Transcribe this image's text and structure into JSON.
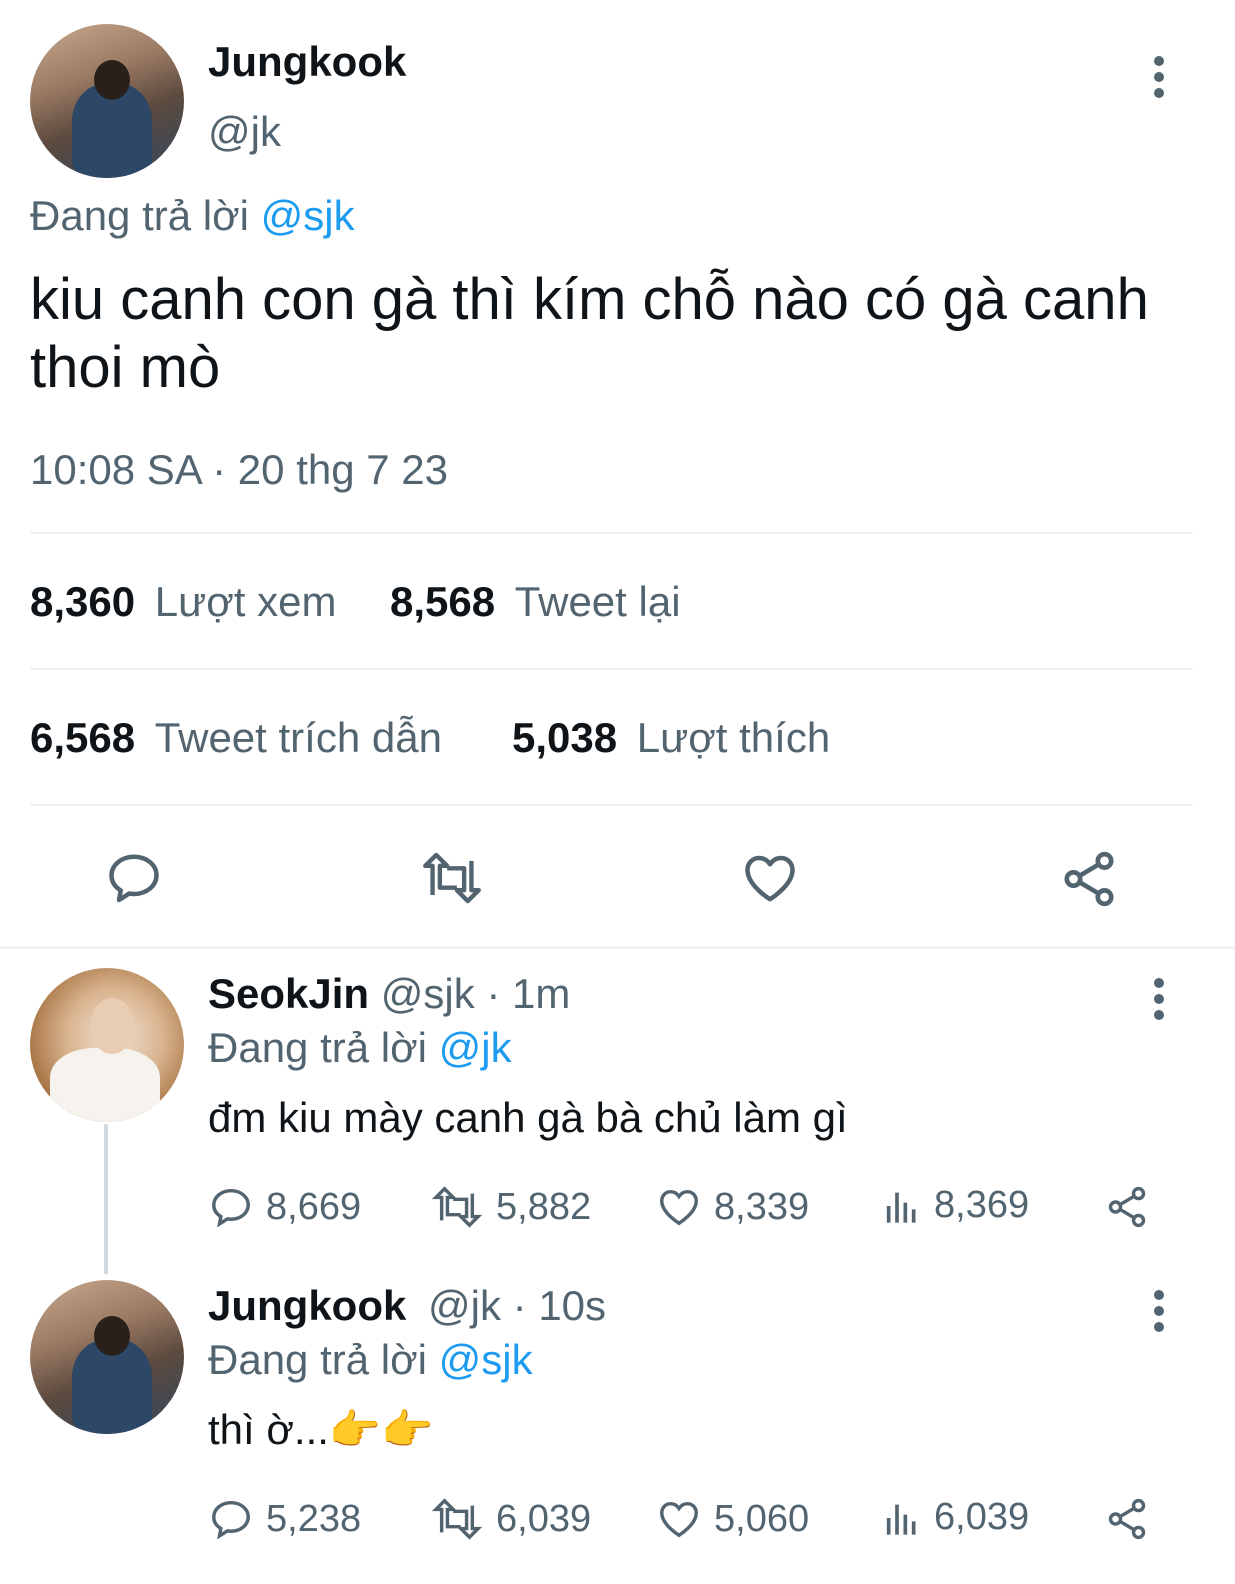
{
  "main_tweet": {
    "author_name": "Jungkook",
    "author_handle": "@jk",
    "replying_prefix": "Đang trả lời",
    "replying_to": "@sjk",
    "text": "kiu canh con gà thì kím chỗ nào có gà canh thoi mò",
    "timestamp": "10:08 SA · 20 thg 7 23",
    "stats": {
      "views_count": "8,360",
      "views_label": "Lượt xem",
      "retweets_count": "8,568",
      "retweets_label": "Tweet lại",
      "quotes_count": "6,568",
      "quotes_label": "Tweet trích dẫn",
      "likes_count": "5,038",
      "likes_label": "Lượt thích"
    }
  },
  "replies": [
    {
      "author_name": "SeokJin",
      "author_handle": "@sjk",
      "time": "· 1m",
      "replying_prefix": "Đang trả lời",
      "replying_to": "@jk",
      "text": "đm kiu mày canh gà bà chủ làm gì",
      "metrics": {
        "replies": "8,669",
        "retweets": "5,882",
        "likes": "8,339",
        "views": "8,369"
      }
    },
    {
      "author_name": "Jungkook",
      "author_handle": "@jk",
      "time": "· 10s",
      "replying_prefix": "Đang trả lời",
      "replying_to": "@sjk",
      "text": "thì ờ...",
      "emoji": "👉👉",
      "metrics": {
        "replies": "5,238",
        "retweets": "6,039",
        "likes": "5,060",
        "views": "6,039"
      }
    }
  ],
  "icons": [
    "reply-icon",
    "retweet-icon",
    "like-icon",
    "share-icon",
    "views-icon",
    "more-icon"
  ],
  "colors": {
    "accent": "#1d9bf0",
    "secondary_text": "#536471",
    "primary_text": "#0f1419",
    "divider": "#eff3f4"
  }
}
